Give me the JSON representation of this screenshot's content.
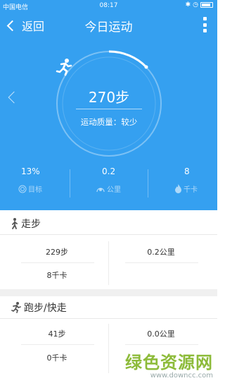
{
  "statusbar": {
    "carrier": "中国电信",
    "time": "08:17"
  },
  "navbar": {
    "back_label": "返回",
    "title": "今日运动"
  },
  "summary": {
    "steps": "270步",
    "quality": "运动质量：较少"
  },
  "stats": [
    {
      "value": "13%",
      "label": "目标",
      "icon": "target-icon"
    },
    {
      "value": "0.2",
      "label": "公里",
      "icon": "speedometer-icon"
    },
    {
      "value": "8",
      "label": "千卡",
      "icon": "flame-icon"
    }
  ],
  "walking": {
    "title": "走步",
    "steps": "229步",
    "distance": "0.2公里",
    "calories": "8千卡"
  },
  "running": {
    "title": "跑步/快走",
    "steps": "41步",
    "distance": "0.0公里",
    "calories": "0千卡"
  },
  "watermark": {
    "main": "绿色资源网",
    "url": "www.downcc.com"
  },
  "colors": {
    "primary": "#35a0f0",
    "watermark": "#8dbb3a"
  }
}
